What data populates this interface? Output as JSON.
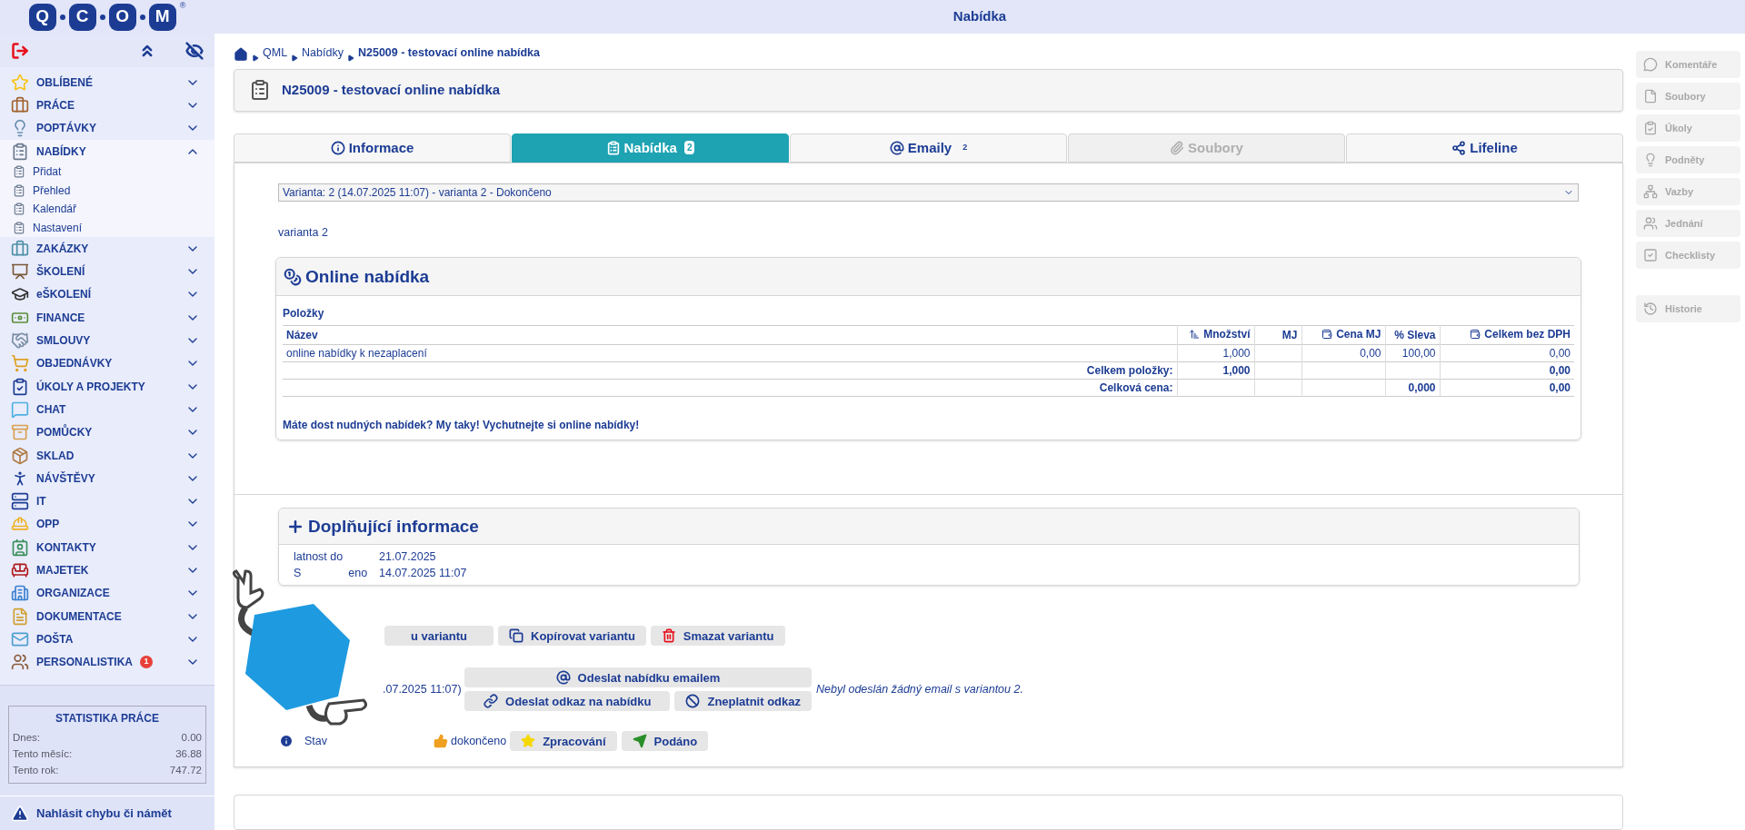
{
  "header": {
    "title": "Nabídka"
  },
  "logo": {
    "letters": [
      "Q",
      "C",
      "O",
      "M"
    ],
    "mark": "®"
  },
  "sidebar": {
    "items": [
      {
        "label": "OBLÍBENÉ",
        "expanded": false
      },
      {
        "label": "PRÁCE",
        "expanded": false
      },
      {
        "label": "POPTÁVKY",
        "expanded": false
      },
      {
        "label": "NABÍDKY",
        "expanded": true,
        "children": [
          {
            "label": "Přidat"
          },
          {
            "label": "Přehled"
          },
          {
            "label": "Kalendář"
          },
          {
            "label": "Nastavení"
          }
        ]
      },
      {
        "label": "ZAKÁZKY",
        "expanded": false
      },
      {
        "label": "ŠKOLENÍ",
        "expanded": false
      },
      {
        "label": "eŠKOLENÍ",
        "expanded": false
      },
      {
        "label": "FINANCE",
        "expanded": false
      },
      {
        "label": "SMLOUVY",
        "expanded": false
      },
      {
        "label": "OBJEDNÁVKY",
        "expanded": false
      },
      {
        "label": "ÚKOLY A PROJEKTY",
        "expanded": false
      },
      {
        "label": "CHAT",
        "expanded": false
      },
      {
        "label": "POMŮCKY",
        "expanded": false
      },
      {
        "label": "SKLAD",
        "expanded": false
      },
      {
        "label": "NÁVŠTĚVY",
        "expanded": false
      },
      {
        "label": "IT",
        "expanded": false
      },
      {
        "label": "OPP",
        "expanded": false
      },
      {
        "label": "KONTAKTY",
        "expanded": false
      },
      {
        "label": "MAJETEK",
        "expanded": false
      },
      {
        "label": "ORGANIZACE",
        "expanded": false
      },
      {
        "label": "DOKUMENTACE",
        "expanded": false
      },
      {
        "label": "POŠTA",
        "expanded": false
      },
      {
        "label": "PERSONALISTIKA",
        "expanded": false,
        "badge": "1"
      }
    ]
  },
  "stats": {
    "title": "STATISTIKA PRÁCE",
    "rows": [
      {
        "label": "Dnes:",
        "value": "0.00"
      },
      {
        "label": "Tento měsíc:",
        "value": "36.88"
      },
      {
        "label": "Tento rok:",
        "value": "747.72"
      }
    ]
  },
  "report_link": "Nahlásit chybu či námět",
  "breadcrumb": [
    "QML",
    "Nabídky",
    "N25009 - testovací online nabídka"
  ],
  "page_title": "N25009 - testovací online nabídka",
  "tabs": [
    {
      "label": "Informace",
      "selected": false,
      "disabled": false
    },
    {
      "label": "Nabídka",
      "selected": true,
      "disabled": false,
      "badge": "2"
    },
    {
      "label": "Emaily",
      "selected": false,
      "disabled": false,
      "count": "2"
    },
    {
      "label": "Soubory",
      "selected": false,
      "disabled": true
    },
    {
      "label": "Lifeline",
      "selected": false,
      "disabled": false
    }
  ],
  "variant_select": {
    "value": "Varianta: 2 (14.07.2025 11:07) - varianta 2 - Dokončeno"
  },
  "variant_name": "varianta 2",
  "online_offer": {
    "title": "Online nabídka",
    "section": "Položky",
    "columns": [
      "Název",
      "Množství",
      "MJ",
      "Cena MJ",
      "% Sleva",
      "Celkem bez DPH"
    ],
    "rows": [
      {
        "cells": [
          "online nabídky k nezaplacení",
          "1,000",
          null,
          "0,00",
          "100,00",
          "0,00"
        ]
      }
    ],
    "totals": [
      {
        "label": "Celkem položky:",
        "cells": [
          "1,000",
          null,
          null,
          null,
          "0,00"
        ]
      },
      {
        "label": "Celková cena:",
        "cells": [
          null,
          null,
          null,
          "0,000",
          "0,00"
        ]
      }
    ],
    "note": "Máte dost nudných nabídek? My taky! Vychutnejte si online nabídky!"
  },
  "details": {
    "title": "Doplňující informace",
    "rows": [
      {
        "label_parts": [
          "latnost do"
        ],
        "value": "21.07.2025"
      },
      {
        "label_parts": [
          "S",
          "eno"
        ],
        "value": "14.07.2025 11:07"
      }
    ]
  },
  "variant_buttons": [
    "u variantu",
    "Kopírovat variantu",
    "Smazat variantu"
  ],
  "email": {
    "date_fragment": ".07.2025 11:07)",
    "send_button": "Odeslat nabídku emailem",
    "link_button": "Odeslat odkaz na nabídku",
    "revoke_button": "Zneplatnit odkaz",
    "note": "Nebyl odeslán žádný email s variantou 2."
  },
  "status": {
    "label": "Stav",
    "value": "dokončeno",
    "buttons": [
      "Zpracování",
      "Podáno"
    ]
  },
  "side_groups": [
    {
      "items": [
        {
          "label": "Komentáře",
          "disabled": true
        },
        {
          "label": "Soubory",
          "disabled": true
        },
        {
          "label": "Úkoly",
          "disabled": true
        },
        {
          "label": "Podněty",
          "disabled": true
        },
        {
          "label": "Vazby",
          "disabled": true
        },
        {
          "label": "Jednání",
          "disabled": true
        },
        {
          "label": "Checklisty",
          "disabled": true
        }
      ]
    },
    {
      "items": [
        {
          "label": "Historie",
          "disabled": true
        }
      ]
    }
  ]
}
